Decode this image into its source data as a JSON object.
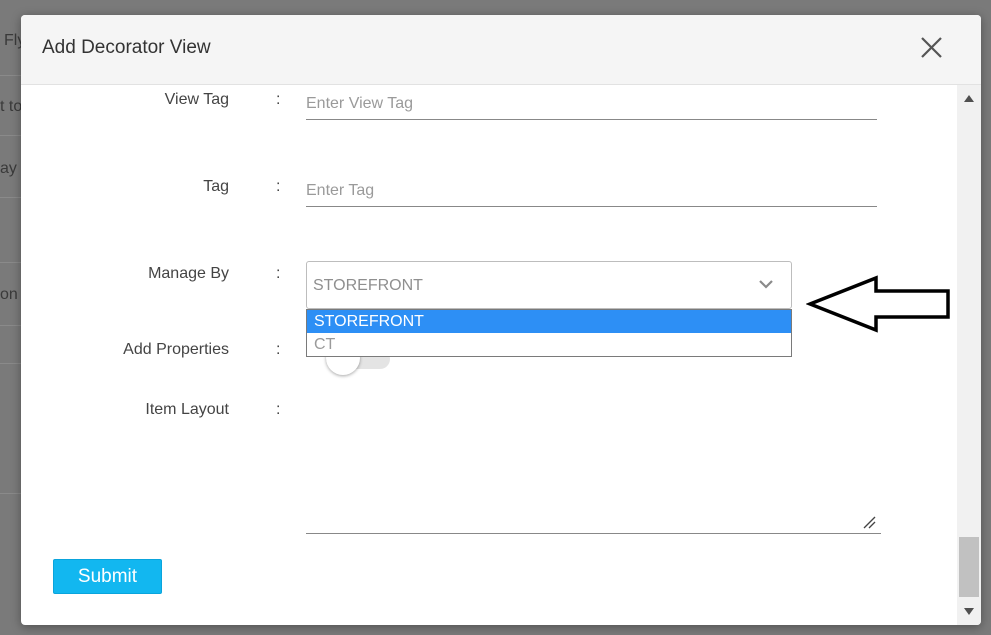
{
  "background": {
    "fragments": [
      "Fly",
      "t to",
      "ay",
      "on"
    ]
  },
  "modal": {
    "title": "Add Decorator View",
    "close_icon": "close-icon"
  },
  "form": {
    "view_tag": {
      "label": "View Tag",
      "colon": ":",
      "placeholder": "Enter View Tag",
      "value": ""
    },
    "tag": {
      "label": "Tag",
      "colon": ":",
      "placeholder": "Enter Tag",
      "value": ""
    },
    "manage_by": {
      "label": "Manage By",
      "colon": ":",
      "selected": "STOREFRONT",
      "options": [
        "STOREFRONT",
        "CT"
      ],
      "highlighted_option": "STOREFRONT"
    },
    "add_properties": {
      "label": "Add Properties",
      "colon": ":",
      "toggle_on": false
    },
    "item_layout": {
      "label": "Item Layout",
      "colon": ":",
      "value": ""
    },
    "submit_label": "Submit"
  },
  "colors": {
    "submit": "#12b7f0",
    "highlight": "#2d8ff5",
    "header_bg": "#f5f5f5",
    "overlay": "#7a7a7a"
  },
  "annotation": {
    "icon": "arrow-left-icon"
  }
}
